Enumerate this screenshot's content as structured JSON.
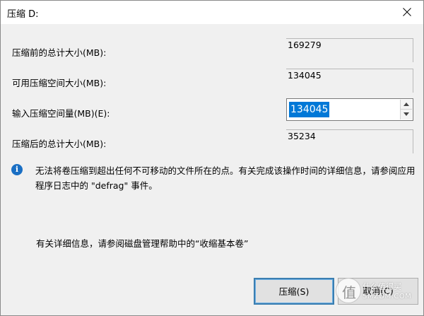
{
  "window": {
    "title": "压缩 D:",
    "close_icon": "close-icon"
  },
  "fields": {
    "total_before": {
      "label": "压缩前的总计大小(MB):",
      "value": "169279"
    },
    "available": {
      "label": "可用压缩空间大小(MB):",
      "value": "134045"
    },
    "input": {
      "label": "输入压缩空间量(MB)(E):",
      "value": "134045"
    },
    "total_after": {
      "label": "压缩后的总计大小(MB):",
      "value": "35234"
    }
  },
  "info": {
    "icon": "info-icon",
    "icon_glyph": "i",
    "message": "无法将卷压缩到超出任何不可移动的文件所在的点。有关完成该操作时间的详细信息，请参阅应用程序日志中的 \"defrag\" 事件。",
    "more_info": "有关详细信息，请参阅磁盘管理帮助中的“收缩基本卷”"
  },
  "buttons": {
    "shrink": "压缩(S)",
    "cancel": "取消(C)"
  },
  "watermark": {
    "glyph": "值",
    "text": "什么值得买",
    "site": "SMZDM.COM"
  },
  "colors": {
    "selection": "#0078d7",
    "default_button_border": "#3c7fb1",
    "info_icon": "#1a6fc4"
  }
}
